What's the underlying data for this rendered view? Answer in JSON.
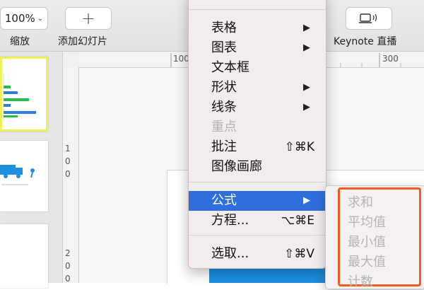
{
  "toolbar": {
    "zoom_value": "100%",
    "zoom_label": "缩放",
    "add_slide_label": "添加幻灯片",
    "keynote_live_label": "Keynote 直播"
  },
  "rulers": {
    "top_ticks": [
      "100",
      "300"
    ],
    "left_ticks": [
      "1",
      "0",
      "0",
      "2",
      "0",
      "0"
    ]
  },
  "menu": {
    "items": [
      {
        "label": "表格",
        "submenu": true
      },
      {
        "label": "图表",
        "submenu": true
      },
      {
        "label": "文本框"
      },
      {
        "label": "形状",
        "submenu": true
      },
      {
        "label": "线条",
        "submenu": true
      },
      {
        "label": "重点",
        "disabled": true
      },
      {
        "label": "批注",
        "shortcut": "⇧⌘K"
      },
      {
        "label": "图像画廊"
      },
      {
        "label": "公式",
        "submenu": true,
        "highlighted": true
      },
      {
        "label": "方程...",
        "shortcut": "⌥⌘E"
      },
      {
        "label": "选取...",
        "shortcut": "⇧⌘V"
      }
    ]
  },
  "submenu": {
    "items": [
      "求和",
      "平均值",
      "最小值",
      "最大值",
      "计数"
    ]
  },
  "colors": {
    "highlight": "#2f6fdc",
    "annotation_box": "#ef5a28",
    "thumb_selected_border": "#eef05a"
  }
}
